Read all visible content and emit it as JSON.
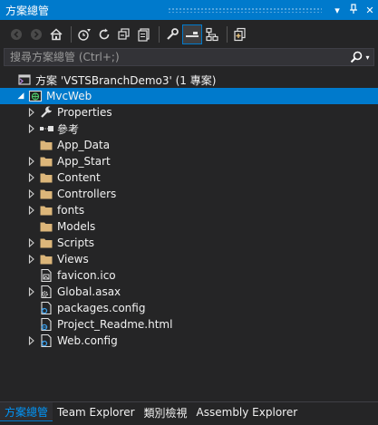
{
  "window": {
    "title": "方案總管",
    "pin_glyph": "▾",
    "pin2_glyph": "ᵠ",
    "close_glyph": "✕"
  },
  "toolbar": {
    "buttons": [
      {
        "name": "back-icon"
      },
      {
        "name": "forward-icon"
      },
      {
        "name": "home-icon"
      },
      {
        "name": "pending-changes-filter-icon"
      },
      {
        "name": "sync-icon"
      },
      {
        "name": "collapse-all-icon"
      },
      {
        "name": "show-all-files-icon"
      },
      {
        "name": "properties-icon"
      },
      {
        "name": "preview-selected-icon"
      },
      {
        "name": "view-class-diagram-icon"
      },
      {
        "name": "new-solution-view-icon"
      }
    ]
  },
  "search": {
    "placeholder": "搜尋方案總管 (Ctrl+;)",
    "icon": "search-icon"
  },
  "tree": {
    "solution": "方案 'VSTSBranchDemo3' (1 專案)",
    "project": "MvcWeb",
    "items": [
      {
        "label": "Properties",
        "icon": "wrench-icon",
        "expandable": true
      },
      {
        "label": "參考",
        "icon": "references-icon",
        "expandable": true
      },
      {
        "label": "App_Data",
        "icon": "folder-icon",
        "expandable": false
      },
      {
        "label": "App_Start",
        "icon": "folder-icon",
        "expandable": true
      },
      {
        "label": "Content",
        "icon": "folder-icon",
        "expandable": true
      },
      {
        "label": "Controllers",
        "icon": "folder-icon",
        "expandable": true
      },
      {
        "label": "fonts",
        "icon": "folder-icon",
        "expandable": true
      },
      {
        "label": "Models",
        "icon": "folder-icon",
        "expandable": false
      },
      {
        "label": "Scripts",
        "icon": "folder-icon",
        "expandable": true
      },
      {
        "label": "Views",
        "icon": "folder-icon",
        "expandable": true
      },
      {
        "label": "favicon.ico",
        "icon": "image-file-icon",
        "expandable": false
      },
      {
        "label": "Global.asax",
        "icon": "gear-file-icon",
        "expandable": true
      },
      {
        "label": "packages.config",
        "icon": "config-file-icon",
        "expandable": false
      },
      {
        "label": "Project_Readme.html",
        "icon": "html-file-icon",
        "expandable": false
      },
      {
        "label": "Web.config",
        "icon": "config-file-icon",
        "expandable": true
      }
    ]
  },
  "tabs": [
    {
      "label": "方案總管",
      "active": true
    },
    {
      "label": "Team Explorer",
      "active": false
    },
    {
      "label": "類別檢視",
      "active": false
    },
    {
      "label": "Assembly Explorer",
      "active": false
    }
  ],
  "colors": {
    "accent": "#007acc",
    "folder": "#dcb67a",
    "background": "#252526"
  }
}
